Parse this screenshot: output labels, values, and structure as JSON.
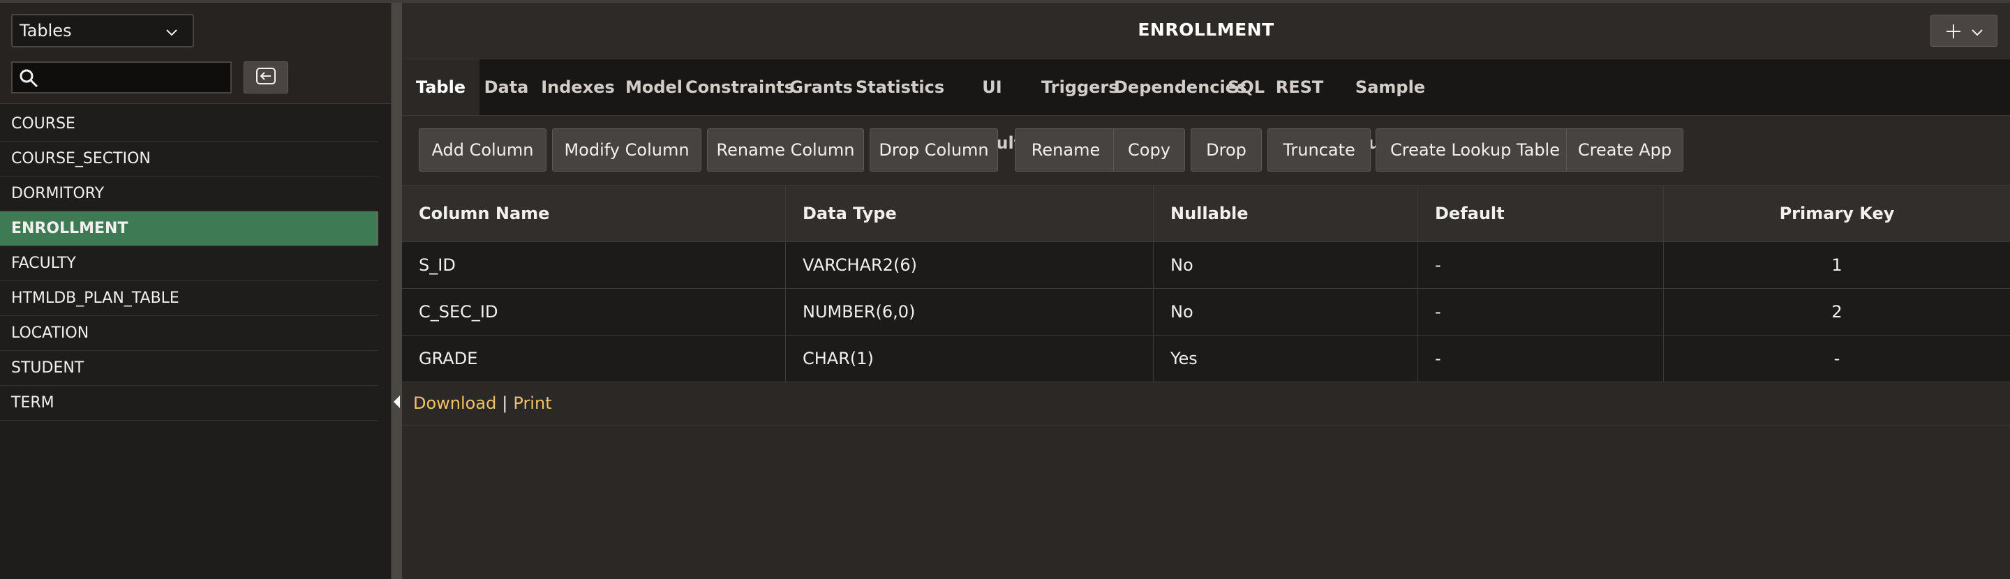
{
  "left_panel": {
    "object_type": "Tables",
    "search": {
      "value": "",
      "placeholder": ""
    },
    "items": [
      {
        "label": "COURSE"
      },
      {
        "label": "COURSE_SECTION"
      },
      {
        "label": "DORMITORY"
      },
      {
        "label": "ENROLLMENT",
        "selected": true
      },
      {
        "label": "FACULTY"
      },
      {
        "label": "HTMLDB_PLAN_TABLE"
      },
      {
        "label": "LOCATION"
      },
      {
        "label": "STUDENT"
      },
      {
        "label": "TERM"
      }
    ]
  },
  "header": {
    "title": "ENROLLMENT"
  },
  "tabs": [
    {
      "label": "Table",
      "active": true
    },
    {
      "label": "Data"
    },
    {
      "label": "Indexes"
    },
    {
      "label": "Model"
    },
    {
      "label": "Constraints"
    },
    {
      "label": "Grants"
    },
    {
      "label": "Statistics"
    },
    {
      "label": "UI Defaults"
    },
    {
      "label": "Triggers"
    },
    {
      "label": "Dependencies"
    },
    {
      "label": "SQL"
    },
    {
      "label": "REST"
    },
    {
      "label": "Sample Queries"
    }
  ],
  "toolbar": [
    "Add Column",
    "Modify Column",
    "Rename Column",
    "Drop Column",
    "Rename",
    "Copy",
    "Drop",
    "Truncate",
    "Create Lookup Table",
    "Create App"
  ],
  "grid": {
    "columns": [
      "Column Name",
      "Data Type",
      "Nullable",
      "Default",
      "Primary Key"
    ],
    "rows": [
      [
        "S_ID",
        "VARCHAR2(6)",
        "No",
        "-",
        "1"
      ],
      [
        "C_SEC_ID",
        "NUMBER(6,0)",
        "No",
        "-",
        "2"
      ],
      [
        "GRADE",
        "CHAR(1)",
        "Yes",
        "-",
        "-"
      ]
    ]
  },
  "footer": {
    "download": "Download",
    "separator": "|",
    "print": "Print"
  },
  "colors": {
    "selected_item": "#3e7b55",
    "link": "#f2c266",
    "background": "#2b2826"
  },
  "icons": [
    "chevron-down-icon",
    "search-icon",
    "back-arrow-icon",
    "plus-icon",
    "collapse-arrow-icon"
  ]
}
